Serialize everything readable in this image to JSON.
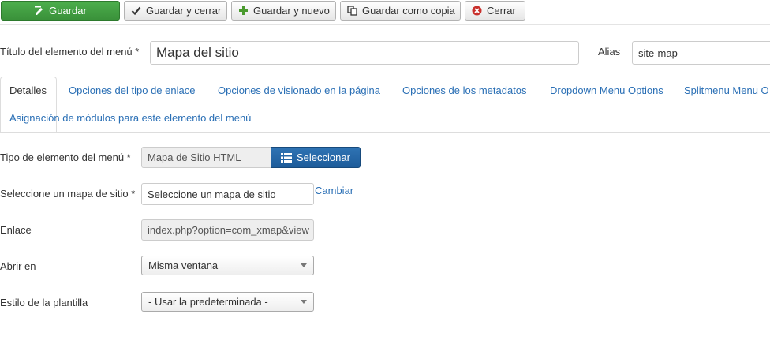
{
  "toolbar": {
    "save": "Guardar",
    "save_close": "Guardar y cerrar",
    "save_new": "Guardar y nuevo",
    "save_copy": "Guardar como copia",
    "close": "Cerrar"
  },
  "title_field": {
    "label": "Título del elemento del menú *",
    "value": "Mapa del sitio"
  },
  "alias_field": {
    "label": "Alias",
    "value": "site-map"
  },
  "tabs": [
    {
      "label": "Detalles",
      "active": true
    },
    {
      "label": "Opciones del tipo de enlace"
    },
    {
      "label": "Opciones de visionado en la página"
    },
    {
      "label": "Opciones de los metadatos"
    },
    {
      "label": "Dropdown Menu Options"
    },
    {
      "label": "Splitmenu Menu O"
    },
    {
      "label": "Asignación de módulos para este elemento del menú"
    }
  ],
  "form": {
    "menu_type": {
      "label": "Tipo de elemento del menú *",
      "value": "Mapa de Sitio HTML",
      "button": "Seleccionar"
    },
    "sitemap": {
      "label": "Seleccione un mapa de sitio *",
      "value": "Seleccione un mapa de sitio",
      "link": "Cambiar"
    },
    "link": {
      "label": "Enlace",
      "value": "index.php?option=com_xmap&view"
    },
    "open_in": {
      "label": "Abrir en",
      "value": "Misma ventana"
    },
    "template_style": {
      "label": "Estilo de la plantilla",
      "value": "- Usar la predeterminada -"
    }
  },
  "colors": {
    "primary_green": "#43a047",
    "link_blue": "#2a6fb5",
    "select_blue": "#1d5c9a",
    "close_red": "#c9302c"
  }
}
